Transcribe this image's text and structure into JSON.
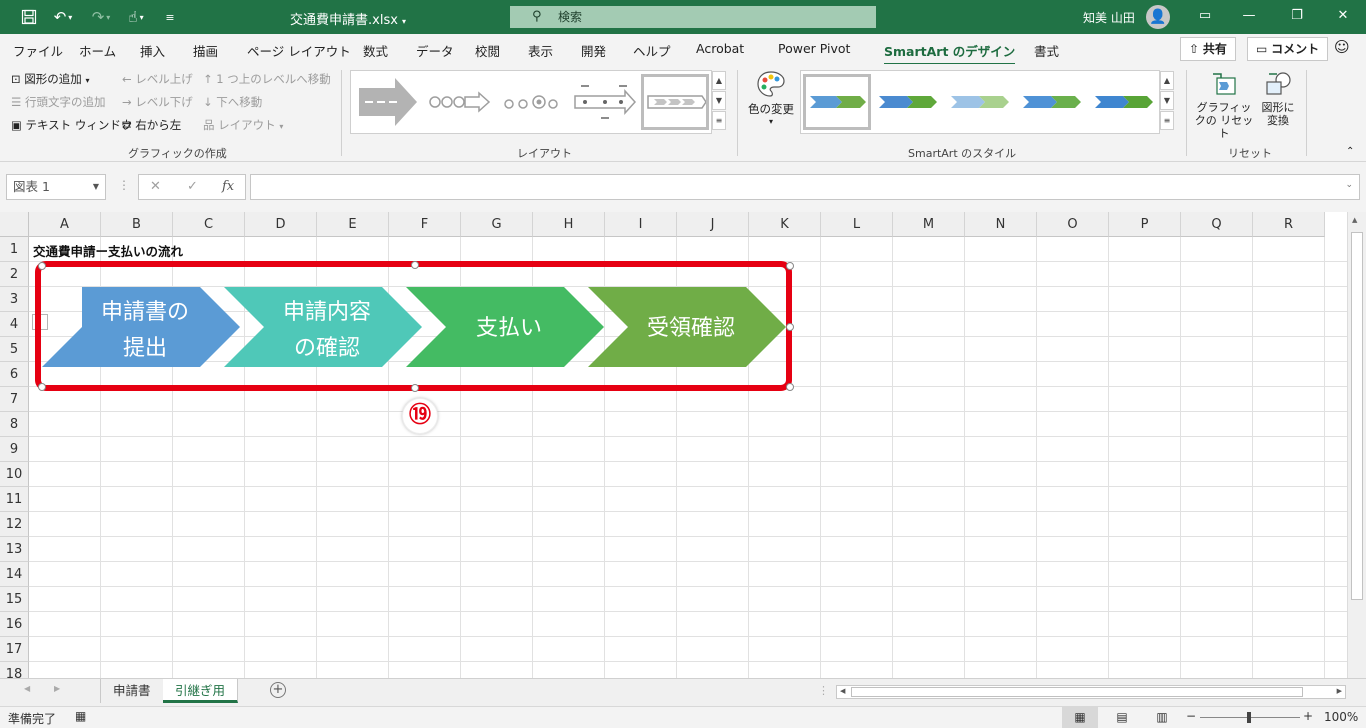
{
  "window": {
    "title": "交通費申請書.xlsx",
    "search_placeholder": "検索",
    "user_name": "知美 山田"
  },
  "tabs": [
    "ファイル",
    "ホーム",
    "挿入",
    "描画",
    "ページ レイアウト",
    "数式",
    "データ",
    "校閲",
    "表示",
    "開発",
    "ヘルプ",
    "Acrobat",
    "Power Pivot",
    "SmartArt のデザイン",
    "書式"
  ],
  "tab_buttons": {
    "share": "共有",
    "comment": "コメント"
  },
  "ribbon": {
    "create_graphic": {
      "add_shape": "図形の追加",
      "promote": "レベル上げ",
      "move_up": "1 つ上のレベルへ移動",
      "add_bullet": "行頭文字の追加",
      "demote": "レベル下げ",
      "move_down": "下へ移動",
      "text_pane": "テキスト ウィンドウ",
      "right_to_left": "右から左",
      "layout": "レイアウト",
      "group_label": "グラフィックの作成"
    },
    "layouts": {
      "group_label": "レイアウト"
    },
    "styles": {
      "change_colors": "色の変更",
      "group_label": "SmartArt のスタイル"
    },
    "reset": {
      "reset_graphic": "グラフィックの リセット",
      "convert": "図形に 変換",
      "group_label": "リセット"
    }
  },
  "formula_bar": {
    "name_box": "図表 1",
    "fx": "fx",
    "value": ""
  },
  "columns": [
    "A",
    "B",
    "C",
    "D",
    "E",
    "F",
    "G",
    "H",
    "I",
    "J",
    "K",
    "L",
    "M",
    "N",
    "O",
    "P",
    "Q",
    "R"
  ],
  "rows": [
    "1",
    "2",
    "3",
    "4",
    "5",
    "6",
    "7",
    "8",
    "9",
    "10",
    "11",
    "12",
    "13",
    "14",
    "15",
    "16",
    "17",
    "18"
  ],
  "cell_a1": "交通費申請ー支払いの流れ",
  "smartart": {
    "steps": [
      {
        "line1": "申請書の",
        "line2": "提出",
        "color": "#5b9bd5"
      },
      {
        "line1": "申請内容",
        "line2": "の確認",
        "color": "#4fc8b8"
      },
      {
        "line1": "支払い",
        "line2": "",
        "color": "#44bb63"
      },
      {
        "line1": "受領確認",
        "line2": "",
        "color": "#70ad47"
      }
    ],
    "highlight_color": "#e60012"
  },
  "step_marker": "⑲",
  "sheets": [
    "申請書",
    "引継ぎ用"
  ],
  "active_sheet": "引継ぎ用",
  "status": {
    "ready": "準備完了",
    "zoom": "100%"
  }
}
